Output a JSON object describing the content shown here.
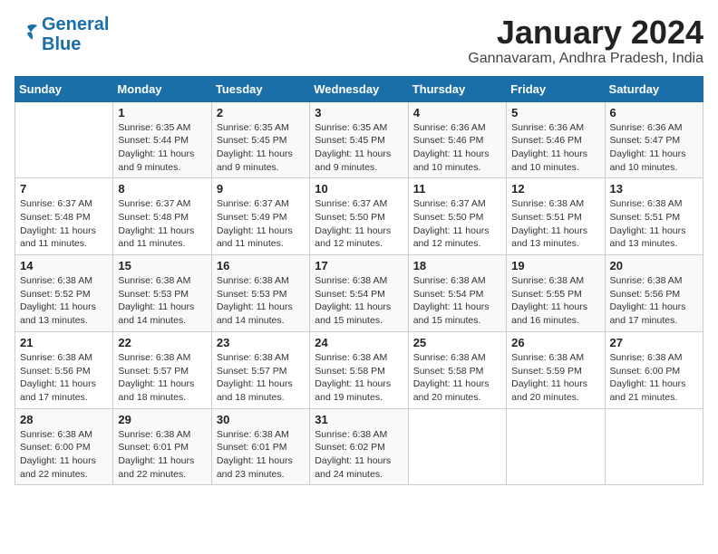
{
  "logo": {
    "line1": "General",
    "line2": "Blue"
  },
  "title": "January 2024",
  "location": "Gannavaram, Andhra Pradesh, India",
  "days_header": [
    "Sunday",
    "Monday",
    "Tuesday",
    "Wednesday",
    "Thursday",
    "Friday",
    "Saturday"
  ],
  "weeks": [
    [
      {
        "num": "",
        "sunrise": "",
        "sunset": "",
        "daylight": ""
      },
      {
        "num": "1",
        "sunrise": "Sunrise: 6:35 AM",
        "sunset": "Sunset: 5:44 PM",
        "daylight": "Daylight: 11 hours and 9 minutes."
      },
      {
        "num": "2",
        "sunrise": "Sunrise: 6:35 AM",
        "sunset": "Sunset: 5:45 PM",
        "daylight": "Daylight: 11 hours and 9 minutes."
      },
      {
        "num": "3",
        "sunrise": "Sunrise: 6:35 AM",
        "sunset": "Sunset: 5:45 PM",
        "daylight": "Daylight: 11 hours and 9 minutes."
      },
      {
        "num": "4",
        "sunrise": "Sunrise: 6:36 AM",
        "sunset": "Sunset: 5:46 PM",
        "daylight": "Daylight: 11 hours and 10 minutes."
      },
      {
        "num": "5",
        "sunrise": "Sunrise: 6:36 AM",
        "sunset": "Sunset: 5:46 PM",
        "daylight": "Daylight: 11 hours and 10 minutes."
      },
      {
        "num": "6",
        "sunrise": "Sunrise: 6:36 AM",
        "sunset": "Sunset: 5:47 PM",
        "daylight": "Daylight: 11 hours and 10 minutes."
      }
    ],
    [
      {
        "num": "7",
        "sunrise": "Sunrise: 6:37 AM",
        "sunset": "Sunset: 5:48 PM",
        "daylight": "Daylight: 11 hours and 11 minutes."
      },
      {
        "num": "8",
        "sunrise": "Sunrise: 6:37 AM",
        "sunset": "Sunset: 5:48 PM",
        "daylight": "Daylight: 11 hours and 11 minutes."
      },
      {
        "num": "9",
        "sunrise": "Sunrise: 6:37 AM",
        "sunset": "Sunset: 5:49 PM",
        "daylight": "Daylight: 11 hours and 11 minutes."
      },
      {
        "num": "10",
        "sunrise": "Sunrise: 6:37 AM",
        "sunset": "Sunset: 5:50 PM",
        "daylight": "Daylight: 11 hours and 12 minutes."
      },
      {
        "num": "11",
        "sunrise": "Sunrise: 6:37 AM",
        "sunset": "Sunset: 5:50 PM",
        "daylight": "Daylight: 11 hours and 12 minutes."
      },
      {
        "num": "12",
        "sunrise": "Sunrise: 6:38 AM",
        "sunset": "Sunset: 5:51 PM",
        "daylight": "Daylight: 11 hours and 13 minutes."
      },
      {
        "num": "13",
        "sunrise": "Sunrise: 6:38 AM",
        "sunset": "Sunset: 5:51 PM",
        "daylight": "Daylight: 11 hours and 13 minutes."
      }
    ],
    [
      {
        "num": "14",
        "sunrise": "Sunrise: 6:38 AM",
        "sunset": "Sunset: 5:52 PM",
        "daylight": "Daylight: 11 hours and 13 minutes."
      },
      {
        "num": "15",
        "sunrise": "Sunrise: 6:38 AM",
        "sunset": "Sunset: 5:53 PM",
        "daylight": "Daylight: 11 hours and 14 minutes."
      },
      {
        "num": "16",
        "sunrise": "Sunrise: 6:38 AM",
        "sunset": "Sunset: 5:53 PM",
        "daylight": "Daylight: 11 hours and 14 minutes."
      },
      {
        "num": "17",
        "sunrise": "Sunrise: 6:38 AM",
        "sunset": "Sunset: 5:54 PM",
        "daylight": "Daylight: 11 hours and 15 minutes."
      },
      {
        "num": "18",
        "sunrise": "Sunrise: 6:38 AM",
        "sunset": "Sunset: 5:54 PM",
        "daylight": "Daylight: 11 hours and 15 minutes."
      },
      {
        "num": "19",
        "sunrise": "Sunrise: 6:38 AM",
        "sunset": "Sunset: 5:55 PM",
        "daylight": "Daylight: 11 hours and 16 minutes."
      },
      {
        "num": "20",
        "sunrise": "Sunrise: 6:38 AM",
        "sunset": "Sunset: 5:56 PM",
        "daylight": "Daylight: 11 hours and 17 minutes."
      }
    ],
    [
      {
        "num": "21",
        "sunrise": "Sunrise: 6:38 AM",
        "sunset": "Sunset: 5:56 PM",
        "daylight": "Daylight: 11 hours and 17 minutes."
      },
      {
        "num": "22",
        "sunrise": "Sunrise: 6:38 AM",
        "sunset": "Sunset: 5:57 PM",
        "daylight": "Daylight: 11 hours and 18 minutes."
      },
      {
        "num": "23",
        "sunrise": "Sunrise: 6:38 AM",
        "sunset": "Sunset: 5:57 PM",
        "daylight": "Daylight: 11 hours and 18 minutes."
      },
      {
        "num": "24",
        "sunrise": "Sunrise: 6:38 AM",
        "sunset": "Sunset: 5:58 PM",
        "daylight": "Daylight: 11 hours and 19 minutes."
      },
      {
        "num": "25",
        "sunrise": "Sunrise: 6:38 AM",
        "sunset": "Sunset: 5:58 PM",
        "daylight": "Daylight: 11 hours and 20 minutes."
      },
      {
        "num": "26",
        "sunrise": "Sunrise: 6:38 AM",
        "sunset": "Sunset: 5:59 PM",
        "daylight": "Daylight: 11 hours and 20 minutes."
      },
      {
        "num": "27",
        "sunrise": "Sunrise: 6:38 AM",
        "sunset": "Sunset: 6:00 PM",
        "daylight": "Daylight: 11 hours and 21 minutes."
      }
    ],
    [
      {
        "num": "28",
        "sunrise": "Sunrise: 6:38 AM",
        "sunset": "Sunset: 6:00 PM",
        "daylight": "Daylight: 11 hours and 22 minutes."
      },
      {
        "num": "29",
        "sunrise": "Sunrise: 6:38 AM",
        "sunset": "Sunset: 6:01 PM",
        "daylight": "Daylight: 11 hours and 22 minutes."
      },
      {
        "num": "30",
        "sunrise": "Sunrise: 6:38 AM",
        "sunset": "Sunset: 6:01 PM",
        "daylight": "Daylight: 11 hours and 23 minutes."
      },
      {
        "num": "31",
        "sunrise": "Sunrise: 6:38 AM",
        "sunset": "Sunset: 6:02 PM",
        "daylight": "Daylight: 11 hours and 24 minutes."
      },
      {
        "num": "",
        "sunrise": "",
        "sunset": "",
        "daylight": ""
      },
      {
        "num": "",
        "sunrise": "",
        "sunset": "",
        "daylight": ""
      },
      {
        "num": "",
        "sunrise": "",
        "sunset": "",
        "daylight": ""
      }
    ]
  ]
}
